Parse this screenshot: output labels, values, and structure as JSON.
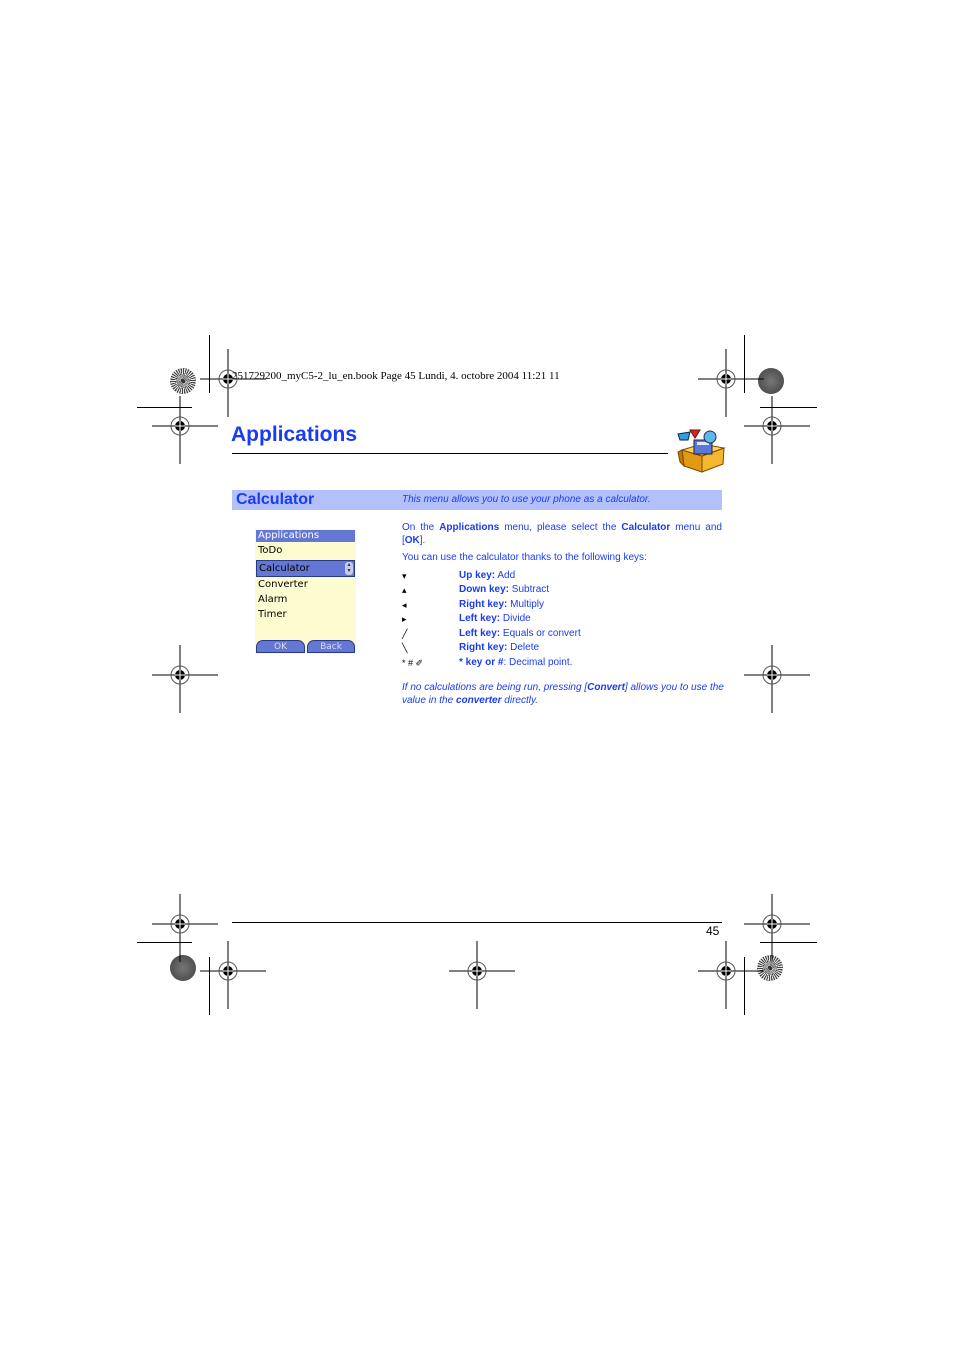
{
  "print_header": "251729200_myC5-2_lu_en.book  Page 45  Lundi, 4. octobre 2004  11:21 11",
  "chapter": {
    "title": "Applications",
    "icon": "applications-toolbox-icon"
  },
  "section": {
    "title": "Calculator",
    "description": "This menu allows you to use your phone as a calculator."
  },
  "phone_screen": {
    "title": "Applications",
    "items": [
      "ToDo",
      "Calculator",
      "Converter",
      "Alarm",
      "Timer"
    ],
    "selected": "Calculator",
    "softkeys": {
      "left": "OK",
      "right": "Back"
    }
  },
  "instructions": {
    "intro": {
      "p1": "On the ",
      "b1": "Applications",
      "p2": " menu, please select the ",
      "b2": "Calculator",
      "p3": " menu and [",
      "b3": "OK",
      "p4": "]."
    },
    "keys_intro": "You can use the calculator thanks to the following keys:",
    "keys": [
      {
        "symbol": "▾",
        "name": "Up key:",
        "action": " Add"
      },
      {
        "symbol": "▴",
        "name": "Down key:",
        "action": " Subtract"
      },
      {
        "symbol": "◂",
        "name": "Right key:",
        "action": " Multiply"
      },
      {
        "symbol": "▸",
        "name": "Left key:",
        "action": " Divide"
      },
      {
        "symbol": "╱",
        "name": "Left key:",
        "action": " Equals or convert"
      },
      {
        "symbol": "╲",
        "name": "Right key:",
        "action": " Delete"
      },
      {
        "symbol": "* # ✐",
        "name": "* key or #",
        "action": ": Decimal point."
      }
    ],
    "note": {
      "p1": "If no calculations are being run, pressing [",
      "b1": "Convert",
      "p2": "] allows you to use the value in the ",
      "b2": "converter",
      "p3": " directly."
    }
  },
  "footer": {
    "page_number": "45"
  },
  "colors": {
    "accent_blue": "#1a3cf0",
    "section_bar": "#b3c0fa",
    "phone_background": "#fdfbd0",
    "phone_highlight": "#6477d2"
  }
}
